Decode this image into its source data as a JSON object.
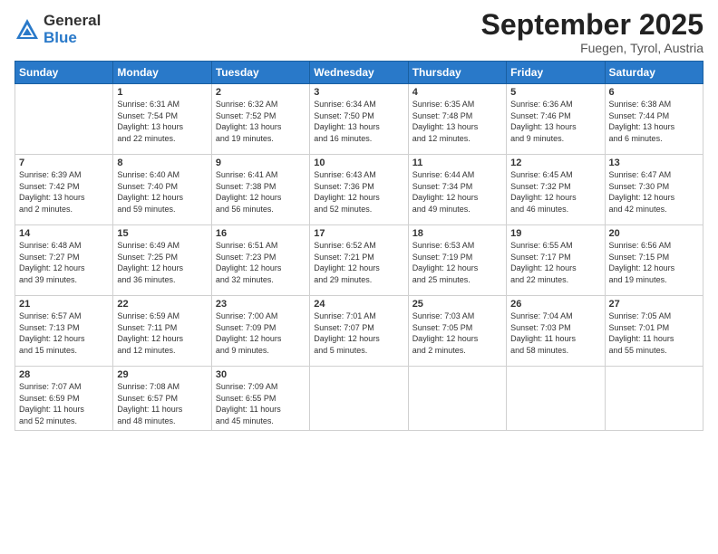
{
  "header": {
    "logo_general": "General",
    "logo_blue": "Blue",
    "month": "September 2025",
    "location": "Fuegen, Tyrol, Austria"
  },
  "days_of_week": [
    "Sunday",
    "Monday",
    "Tuesday",
    "Wednesday",
    "Thursday",
    "Friday",
    "Saturday"
  ],
  "weeks": [
    [
      {
        "day": "",
        "info": ""
      },
      {
        "day": "1",
        "info": "Sunrise: 6:31 AM\nSunset: 7:54 PM\nDaylight: 13 hours\nand 22 minutes."
      },
      {
        "day": "2",
        "info": "Sunrise: 6:32 AM\nSunset: 7:52 PM\nDaylight: 13 hours\nand 19 minutes."
      },
      {
        "day": "3",
        "info": "Sunrise: 6:34 AM\nSunset: 7:50 PM\nDaylight: 13 hours\nand 16 minutes."
      },
      {
        "day": "4",
        "info": "Sunrise: 6:35 AM\nSunset: 7:48 PM\nDaylight: 13 hours\nand 12 minutes."
      },
      {
        "day": "5",
        "info": "Sunrise: 6:36 AM\nSunset: 7:46 PM\nDaylight: 13 hours\nand 9 minutes."
      },
      {
        "day": "6",
        "info": "Sunrise: 6:38 AM\nSunset: 7:44 PM\nDaylight: 13 hours\nand 6 minutes."
      }
    ],
    [
      {
        "day": "7",
        "info": "Sunrise: 6:39 AM\nSunset: 7:42 PM\nDaylight: 13 hours\nand 2 minutes."
      },
      {
        "day": "8",
        "info": "Sunrise: 6:40 AM\nSunset: 7:40 PM\nDaylight: 12 hours\nand 59 minutes."
      },
      {
        "day": "9",
        "info": "Sunrise: 6:41 AM\nSunset: 7:38 PM\nDaylight: 12 hours\nand 56 minutes."
      },
      {
        "day": "10",
        "info": "Sunrise: 6:43 AM\nSunset: 7:36 PM\nDaylight: 12 hours\nand 52 minutes."
      },
      {
        "day": "11",
        "info": "Sunrise: 6:44 AM\nSunset: 7:34 PM\nDaylight: 12 hours\nand 49 minutes."
      },
      {
        "day": "12",
        "info": "Sunrise: 6:45 AM\nSunset: 7:32 PM\nDaylight: 12 hours\nand 46 minutes."
      },
      {
        "day": "13",
        "info": "Sunrise: 6:47 AM\nSunset: 7:30 PM\nDaylight: 12 hours\nand 42 minutes."
      }
    ],
    [
      {
        "day": "14",
        "info": "Sunrise: 6:48 AM\nSunset: 7:27 PM\nDaylight: 12 hours\nand 39 minutes."
      },
      {
        "day": "15",
        "info": "Sunrise: 6:49 AM\nSunset: 7:25 PM\nDaylight: 12 hours\nand 36 minutes."
      },
      {
        "day": "16",
        "info": "Sunrise: 6:51 AM\nSunset: 7:23 PM\nDaylight: 12 hours\nand 32 minutes."
      },
      {
        "day": "17",
        "info": "Sunrise: 6:52 AM\nSunset: 7:21 PM\nDaylight: 12 hours\nand 29 minutes."
      },
      {
        "day": "18",
        "info": "Sunrise: 6:53 AM\nSunset: 7:19 PM\nDaylight: 12 hours\nand 25 minutes."
      },
      {
        "day": "19",
        "info": "Sunrise: 6:55 AM\nSunset: 7:17 PM\nDaylight: 12 hours\nand 22 minutes."
      },
      {
        "day": "20",
        "info": "Sunrise: 6:56 AM\nSunset: 7:15 PM\nDaylight: 12 hours\nand 19 minutes."
      }
    ],
    [
      {
        "day": "21",
        "info": "Sunrise: 6:57 AM\nSunset: 7:13 PM\nDaylight: 12 hours\nand 15 minutes."
      },
      {
        "day": "22",
        "info": "Sunrise: 6:59 AM\nSunset: 7:11 PM\nDaylight: 12 hours\nand 12 minutes."
      },
      {
        "day": "23",
        "info": "Sunrise: 7:00 AM\nSunset: 7:09 PM\nDaylight: 12 hours\nand 9 minutes."
      },
      {
        "day": "24",
        "info": "Sunrise: 7:01 AM\nSunset: 7:07 PM\nDaylight: 12 hours\nand 5 minutes."
      },
      {
        "day": "25",
        "info": "Sunrise: 7:03 AM\nSunset: 7:05 PM\nDaylight: 12 hours\nand 2 minutes."
      },
      {
        "day": "26",
        "info": "Sunrise: 7:04 AM\nSunset: 7:03 PM\nDaylight: 11 hours\nand 58 minutes."
      },
      {
        "day": "27",
        "info": "Sunrise: 7:05 AM\nSunset: 7:01 PM\nDaylight: 11 hours\nand 55 minutes."
      }
    ],
    [
      {
        "day": "28",
        "info": "Sunrise: 7:07 AM\nSunset: 6:59 PM\nDaylight: 11 hours\nand 52 minutes."
      },
      {
        "day": "29",
        "info": "Sunrise: 7:08 AM\nSunset: 6:57 PM\nDaylight: 11 hours\nand 48 minutes."
      },
      {
        "day": "30",
        "info": "Sunrise: 7:09 AM\nSunset: 6:55 PM\nDaylight: 11 hours\nand 45 minutes."
      },
      {
        "day": "",
        "info": ""
      },
      {
        "day": "",
        "info": ""
      },
      {
        "day": "",
        "info": ""
      },
      {
        "day": "",
        "info": ""
      }
    ]
  ]
}
